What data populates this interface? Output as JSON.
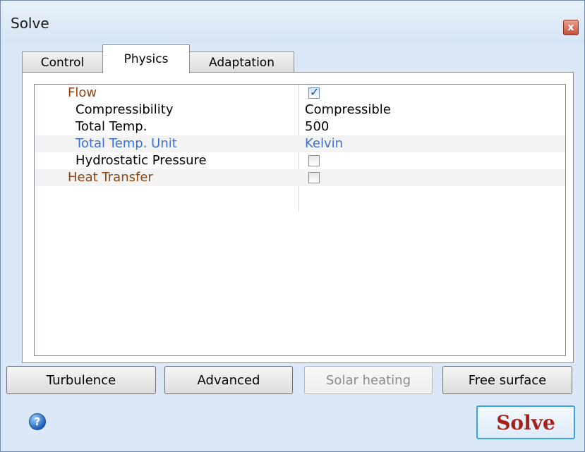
{
  "window": {
    "title": "Solve",
    "close_glyph": "x"
  },
  "tabs": [
    {
      "label": "Control",
      "active": false
    },
    {
      "label": "Physics",
      "active": true
    },
    {
      "label": "Adaptation",
      "active": false
    }
  ],
  "properties": [
    {
      "name": "Flow",
      "type": "checkbox",
      "checked": true,
      "color": "#8b4513"
    },
    {
      "name": "Compressibility",
      "type": "text",
      "value": "Compressible",
      "color": "#000000"
    },
    {
      "name": "Total Temp.",
      "type": "text",
      "value": "500",
      "color": "#000000"
    },
    {
      "name": "Total Temp. Unit",
      "type": "text",
      "value": "Kelvin",
      "color": "#3b6fd6"
    },
    {
      "name": "Hydrostatic Pressure",
      "type": "checkbox",
      "checked": false,
      "color": "#000000"
    },
    {
      "name": "Heat Transfer",
      "type": "checkbox",
      "checked": false,
      "color": "#8b4513"
    }
  ],
  "buttons": {
    "turbulence": "Turbulence",
    "advanced": "Advanced",
    "solar_heating": "Solar heating",
    "free_surface": "Free surface",
    "solve": "Solve"
  },
  "colors": {
    "category": "#8b4513",
    "highlight": "#3b6fd6",
    "solve_text": "#a8201a",
    "solve_border": "#3ca2e0"
  },
  "icons": {
    "help": "help-icon",
    "close": "close-icon",
    "check": "checkmark-icon"
  }
}
